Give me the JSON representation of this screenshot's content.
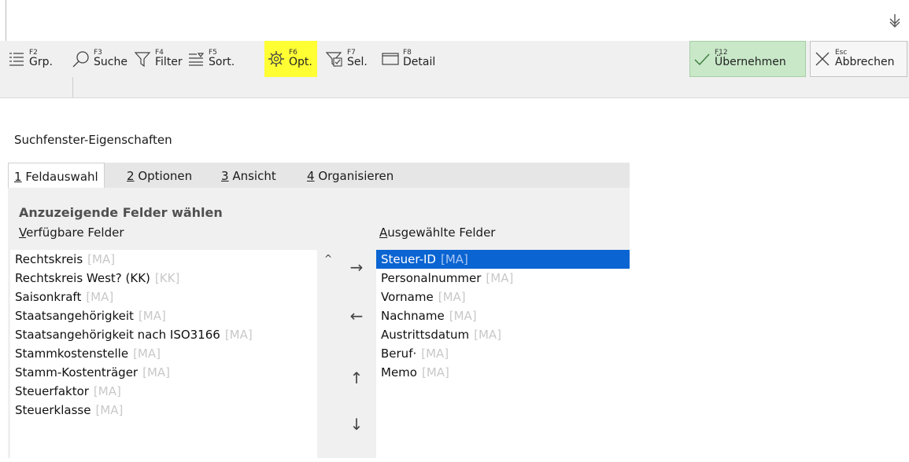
{
  "toolbar": {
    "items": [
      {
        "key": "F2",
        "label": "Grp.",
        "icon": "group-list-icon"
      },
      {
        "key": "F3",
        "label": "Suche",
        "icon": "search-icon"
      },
      {
        "key": "F4",
        "label": "Filter",
        "icon": "filter-icon"
      },
      {
        "key": "F5",
        "label": "Sort.",
        "icon": "sort-icon"
      },
      {
        "key": "F6",
        "label": "Opt.",
        "icon": "gear-icon",
        "highlight": "#ffff33"
      },
      {
        "key": "F7",
        "label": "Sel.",
        "icon": "filter-check-icon"
      },
      {
        "key": "F8",
        "label": "Detail",
        "icon": "window-icon"
      }
    ],
    "accept": {
      "key": "F12",
      "label": "Übernehmen",
      "icon": "check-icon"
    },
    "cancel": {
      "key": "Esc",
      "label": "Abbrechen",
      "icon": "close-icon"
    },
    "download_icon": "double-arrow-down-icon"
  },
  "dialog": {
    "title": "Suchfenster-Eigenschaften",
    "tabs": [
      {
        "acc": "1",
        "label": " Feldauswahl",
        "active": true
      },
      {
        "acc": "2",
        "label": " Optionen"
      },
      {
        "acc": "3",
        "label": " Ansicht"
      },
      {
        "acc": "4",
        "label": " Organisieren"
      }
    ],
    "section_title": "Anzuzeigende Felder wählen",
    "available": {
      "label_acc": "V",
      "label_rest": "erfügbare Felder",
      "items": [
        {
          "name": "Rechtskreis",
          "tag": "[MA]"
        },
        {
          "name": "Rechtskreis West? (KK)",
          "tag": "[KK]"
        },
        {
          "name": "Saisonkraft",
          "tag": "[MA]"
        },
        {
          "name": "Staatsangehörigkeit",
          "tag": "[MA]"
        },
        {
          "name": "Staatsangehörigkeit nach ISO3166",
          "tag": "[MA]"
        },
        {
          "name": "Stammkostenstelle",
          "tag": "[MA]"
        },
        {
          "name": "Stamm-Kostenträger",
          "tag": "[MA]"
        },
        {
          "name": "Steuerfaktor",
          "tag": "[MA]"
        },
        {
          "name": "Steuerklasse",
          "tag": "[MA]"
        }
      ]
    },
    "selected": {
      "label_acc": "A",
      "label_rest": "usgewählte Felder",
      "items": [
        {
          "name": "Steuer-ID",
          "tag": "[MA]",
          "selected": true
        },
        {
          "name": "Personalnummer",
          "tag": "[MA]"
        },
        {
          "name": "Vorname",
          "tag": "[MA]"
        },
        {
          "name": "Nachname",
          "tag": "[MA]"
        },
        {
          "name": "Austrittsdatum",
          "tag": "[MA]"
        },
        {
          "name": "Beruf·",
          "tag": "[MA]"
        },
        {
          "name": "Memo",
          "tag": "[MA]"
        }
      ]
    },
    "buttons": {
      "add": "→",
      "remove": "←",
      "move_up": "↑",
      "move_down": "↓",
      "scroll_up": "^"
    },
    "selection_color": "#0a64d2"
  }
}
